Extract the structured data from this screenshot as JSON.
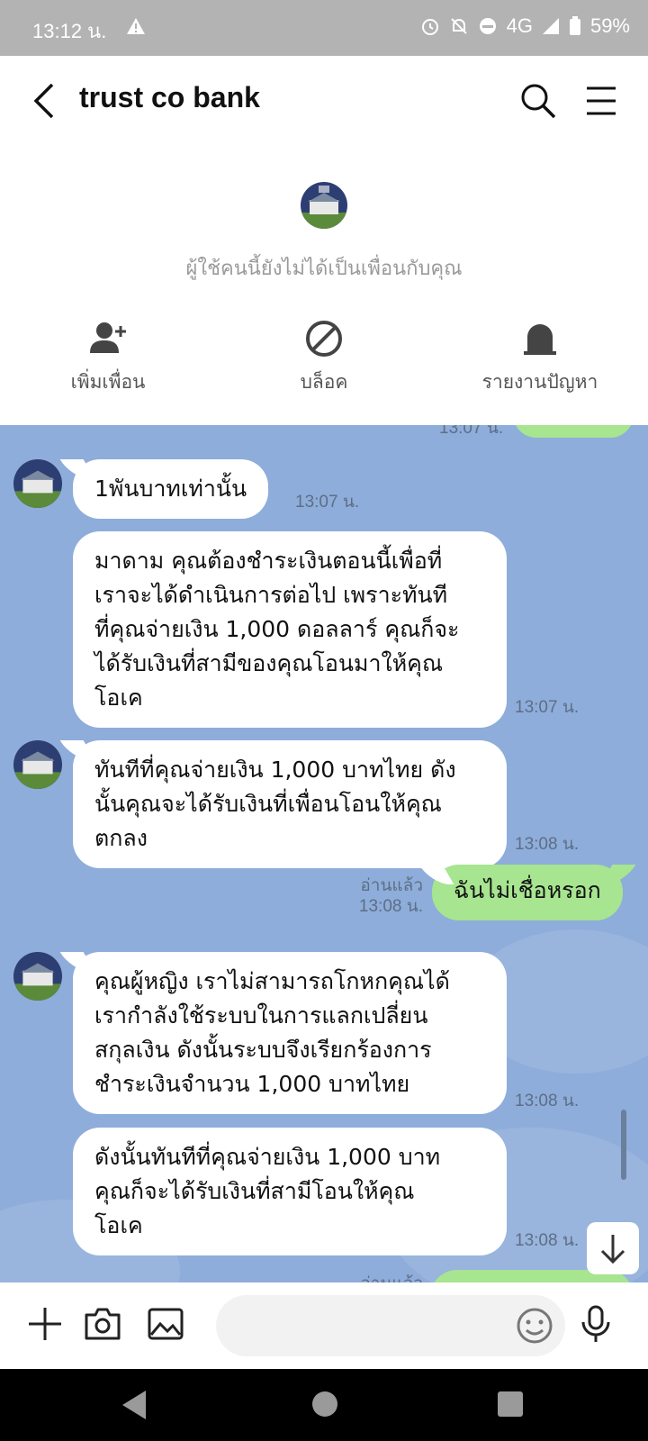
{
  "status_bar": {
    "time": "13:12 น.",
    "network": "4G",
    "battery": "59%"
  },
  "header": {
    "title": "trust co bank"
  },
  "info": {
    "note": "ผู้ใช้คนนี้ยังไม่ได้เป็นเพื่อนกับคุณ",
    "actions": [
      {
        "label": "เพิ่มเพื่อน",
        "icon": "add-friend-icon"
      },
      {
        "label": "บล็อค",
        "icon": "block-icon"
      },
      {
        "label": "รายงานปัญหา",
        "icon": "report-icon"
      }
    ]
  },
  "messages": [
    {
      "from": "me",
      "text": "",
      "time": "13:07 น.",
      "partial": true
    },
    {
      "from": "them",
      "text": "1พันบาทเท่านั้น",
      "time": "13:07 น."
    },
    {
      "from": "them",
      "text": "มาดาม คุณต้องชำระเงินตอนนี้เพื่อที่\nเราจะได้ดำเนินการต่อไป เพราะทันที\nที่คุณจ่ายเงิน 1,000 ดอลลาร์ คุณก็จะ\nได้รับเงินที่สามีของคุณโอนมาให้คุณ\nโอเค",
      "time": "13:07 น."
    },
    {
      "from": "them",
      "text": "ทันทีที่คุณจ่ายเงิน 1,000 บาทไทย ดัง\nนั้นคุณจะได้รับเงินที่เพื่อนโอนให้คุณ\nตกลง",
      "time": "13:08 น."
    },
    {
      "from": "me",
      "text": "ฉันไม่เชื่อหรอก",
      "time": "13:08 น.",
      "read": "อ่านแล้ว"
    },
    {
      "from": "them",
      "text": "คุณผู้หญิง เราไม่สามารถโกหกคุณได้\nเรากำลังใช้ระบบในการแลกเปลี่ยน\nสกุลเงิน ดังนั้นระบบจึงเรียกร้องการ\nชำระเงินจำนวน 1,000 บาทไทย",
      "time": "13:08 น."
    },
    {
      "from": "them",
      "text": "ดังนั้นทันทีที่คุณจ่ายเงิน 1,000 บาท\nคุณก็จะได้รับเงินที่สามีโอนให้คุณ\nโอเค",
      "time": "13:08 น."
    },
    {
      "from": "me",
      "text": "",
      "time": "",
      "read": "อ่านแล้ว",
      "partial": true
    }
  ],
  "input": {
    "placeholder": ""
  },
  "colors": {
    "chat_bg": "#8eadda",
    "my_bubble": "#a7e590",
    "their_bubble": "#ffffff",
    "status_bar": "#b3b3b3"
  }
}
